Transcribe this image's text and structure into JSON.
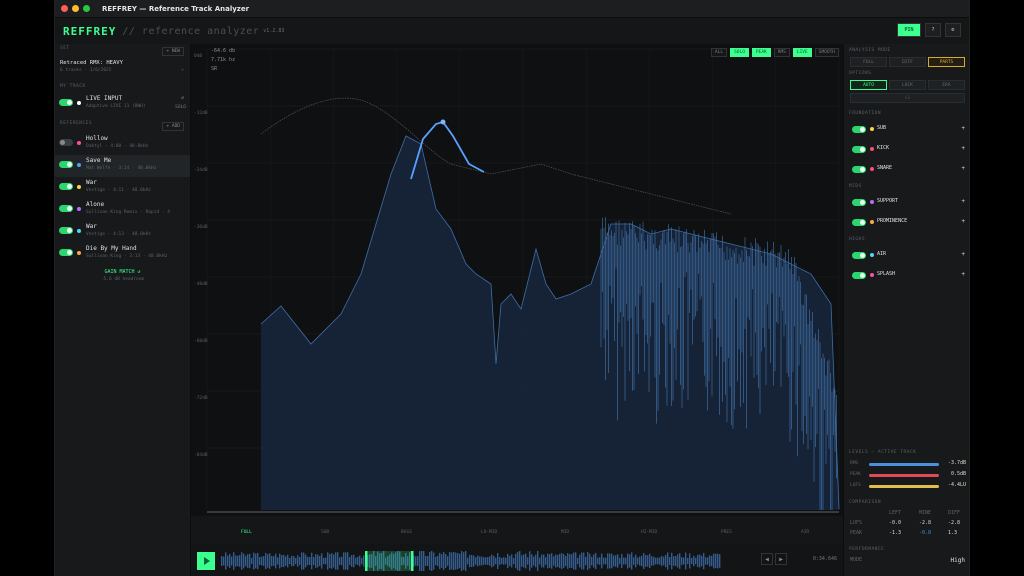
{
  "window": {
    "title": "REFFREY — Reference Track Analyzer"
  },
  "app": {
    "logo": "REFFREY",
    "subtitle": "// reference analyzer",
    "version": "v1.2.83"
  },
  "header_buttons": {
    "pin": "PIN",
    "help": "?",
    "settings": "⚙"
  },
  "left": {
    "set_label": "SET",
    "new_btn": "+ NEW",
    "set_name": "Retraced RMX: HEAVY",
    "set_meta": "6 tracks · 1/6/2025",
    "my_track_label": "MY TRACK",
    "live_input": "LIVE INPUT",
    "live_input_sub": "Adaptive LIVE 11 (BWH)",
    "solo": "SOLO",
    "references_label": "REFERENCES",
    "add_btn": "+ ADD",
    "refs": [
      {
        "name": "Hollow",
        "sub": "Daktyl · 4:00 · 48.0kHz",
        "color": "#ff4fa0",
        "on": false
      },
      {
        "name": "Save Me",
        "sub": "Mat Wolfe · 3:14 · 48.0kHz",
        "color": "#4aa0ff",
        "on": true
      },
      {
        "name": "War",
        "sub": "Vestige · 4:11 · 48.0kHz",
        "color": "#ffd04a",
        "on": true
      },
      {
        "name": "Alone",
        "sub": "Sullivan King Remix · Rapid · 4",
        "color": "#b66bff",
        "on": true
      },
      {
        "name": "War",
        "sub": "Vestige · 4:13 · 48.0kHz",
        "color": "#4ad7ff",
        "on": true
      },
      {
        "name": "Die By My Hand",
        "sub": "Sullivan King · 3:13 · 48.0kHz",
        "color": "#ffa64a",
        "on": true
      }
    ],
    "gain_match": "GAIN MATCH ↺",
    "gain_match_sub": "-5.6 dB headroom"
  },
  "plot": {
    "readout": [
      "-64.6 db",
      "7.71k hz",
      "SR"
    ],
    "view_buttons": [
      "ALL",
      "SOLO",
      "PEAK",
      "RMS",
      "LIVE",
      "SMOOTH"
    ],
    "view_active": [
      false,
      true,
      true,
      false,
      true,
      false
    ],
    "y_labels": [
      "0dB",
      "-12dB",
      "-24dB",
      "-36dB",
      "-48dB",
      "-60dB",
      "-72dB",
      "-84dB"
    ],
    "x_labels": [
      "0",
      "20",
      "50",
      "100",
      "200",
      "500",
      "1k",
      "2k",
      "5k",
      "10k",
      "20k"
    ],
    "bands": [
      "FULL",
      "SUB",
      "BASS",
      "LO-MID",
      "MID",
      "HI-MID",
      "PRES",
      "AIR"
    ]
  },
  "right": {
    "analysis_mode": "ANALYSIS MODE",
    "modes": [
      "FULL",
      "DIFF",
      "PARTS"
    ],
    "options_label": "OPTIONS",
    "options": [
      "AUTO",
      "LOCK",
      "ERA"
    ],
    "foundation": "FOUNDATION",
    "found_items": [
      {
        "label": "SUB",
        "color": "#ffd04a"
      },
      {
        "label": "KICK",
        "color": "#ff4f6a"
      },
      {
        "label": "SNARE",
        "color": "#ff4f6a"
      }
    ],
    "mids": "MIDS",
    "mid_items": [
      {
        "label": "SUPPORT",
        "color": "#b66bff"
      },
      {
        "label": "PROMINENCE",
        "color": "#ffa64a"
      }
    ],
    "highs": "HIGHS",
    "high_items": [
      {
        "label": "AIR",
        "color": "#4ad7ff"
      },
      {
        "label": "SPLASH",
        "color": "#ff4fa0"
      }
    ],
    "levels_label": "LEVELS — ACTIVE TRACK",
    "levels": [
      {
        "k": "RMS",
        "v": "-3.7dB",
        "color": "#4a8fe0"
      },
      {
        "k": "PEAK",
        "v": "0.5dB",
        "color": "#e04a5a"
      },
      {
        "k": "LUFS",
        "v": "-4.4LU",
        "color": "#e0c04a"
      }
    ],
    "comparison": "COMPARISON",
    "cmp_heads": [
      "LEFT",
      "MINE",
      "DIFF"
    ],
    "cmp_rows": [
      {
        "k": "LUFS",
        "a": "-0.0",
        "b": "-2.8",
        "c": "-2.8"
      },
      {
        "k": "PEAK",
        "a": "-1.3",
        "b": "-0.0",
        "c": "1.3"
      }
    ],
    "performance": "PERFORMANCE",
    "mode_label": "MODE",
    "mode_value": "High"
  },
  "transport": {
    "time": "0:34.646"
  }
}
